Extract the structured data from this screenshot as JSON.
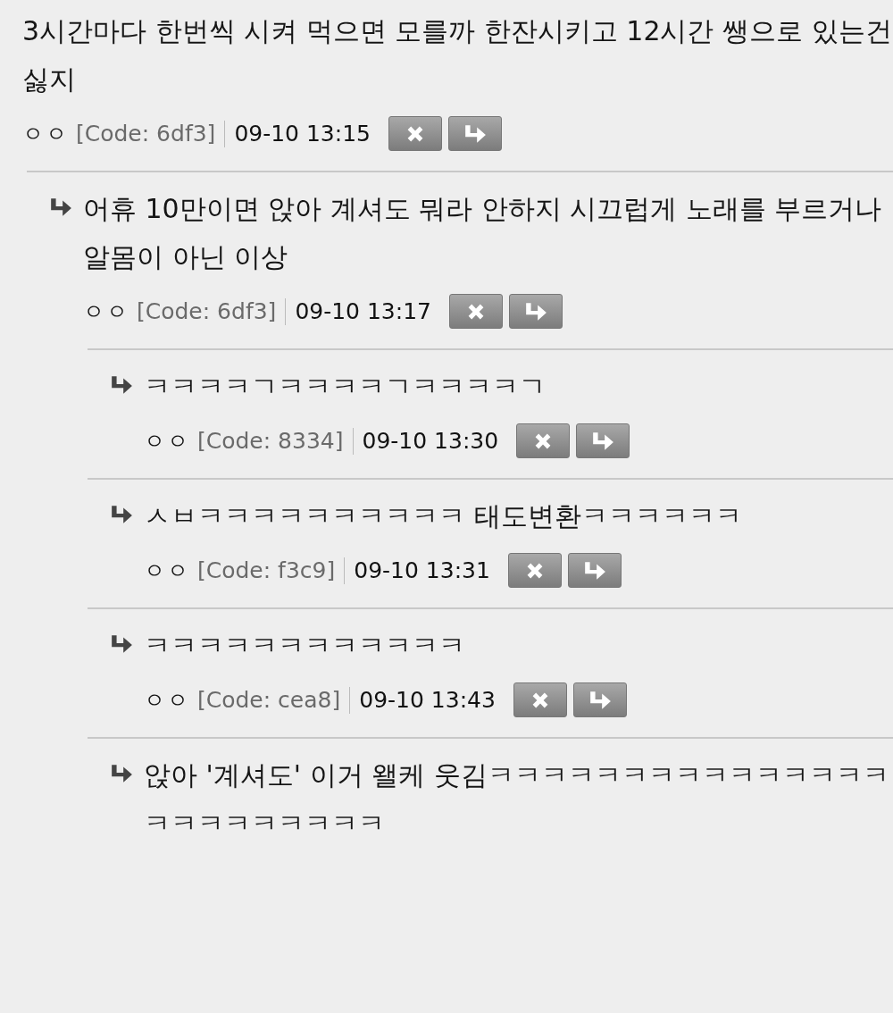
{
  "comments": [
    {
      "text": "3시간마다 한번씩 시켜 먹으면 모를까 한잔시키고 12시간 쌩으로 있는건 싫지",
      "nickname": "ㅇㅇ",
      "code": "[Code: 6df3]",
      "time": "09-10 13:15",
      "children": [
        {
          "text": "어휴 10만이면 앉아 계셔도 뭐라 안하지 시끄럽게 노래를 부르거나 알몸이 아닌 이상",
          "nickname": "ㅇㅇ",
          "code": "[Code: 6df3]",
          "time": "09-10 13:17",
          "children": [
            {
              "text": "ㅋㅋㅋㅋㄱㅋㅋㅋㅋㄱㅋㅋㅋㅋㄱ",
              "nickname": "ㅇㅇ",
              "code": "[Code: 8334]",
              "time": "09-10 13:30"
            },
            {
              "text": "ㅅㅂㅋㅋㅋㅋㅋㅋㅋㅋㅋㅋ 태도변환ㅋㅋㅋㅋㅋㅋ",
              "nickname": "ㅇㅇ",
              "code": "[Code: f3c9]",
              "time": "09-10 13:31"
            },
            {
              "text": "ㅋㅋㅋㅋㅋㅋㅋㅋㅋㅋㅋㅋ",
              "nickname": "ㅇㅇ",
              "code": "[Code: cea8]",
              "time": "09-10 13:43"
            },
            {
              "text": "앉아 '계셔도' 이거 왤케 웃김ㅋㅋㅋㅋㅋㅋㅋㅋㅋㅋㅋㅋㅋㅋㅋㅋㅋㅋㅋㅋㅋㅋㅋㅋ"
            }
          ]
        }
      ]
    }
  ]
}
